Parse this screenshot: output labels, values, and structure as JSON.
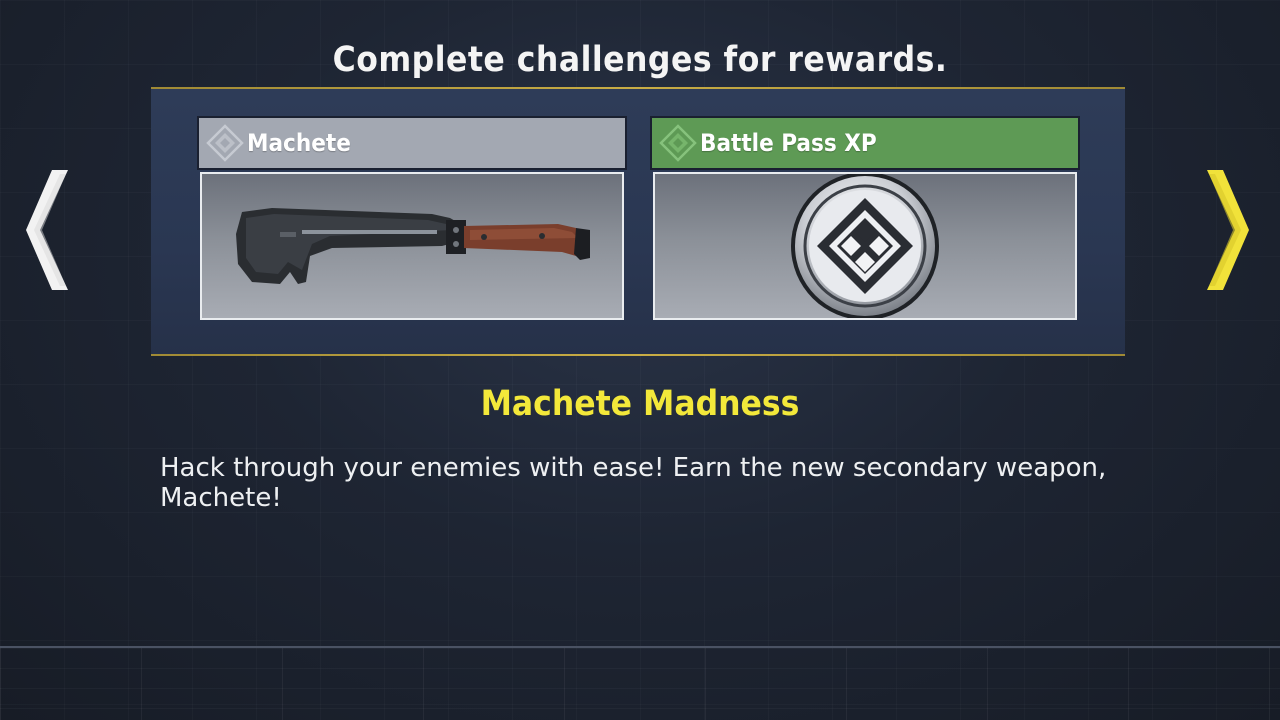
{
  "header": {
    "title": "Complete challenges for rewards."
  },
  "rewards": [
    {
      "label": "Machete",
      "icon": "machete-image",
      "header_color": "#a3a8b2"
    },
    {
      "label": "Battle Pass XP",
      "icon": "battle-pass-xp-emblem",
      "header_color": "#5e9a55"
    }
  ],
  "navigation": {
    "prev_icon": "chevron-left-icon",
    "next_icon": "chevron-right-icon",
    "prev_color": "#f2f2f2",
    "next_color": "#f1e23a"
  },
  "challenge": {
    "title": "Machete Madness",
    "description": "Hack through your enemies with ease! Earn the new secondary weapon, Machete!"
  },
  "colors": {
    "accent_gold": "#c9ad45",
    "title_yellow": "#f3e83a",
    "panel_blue": "#2e3c58"
  }
}
